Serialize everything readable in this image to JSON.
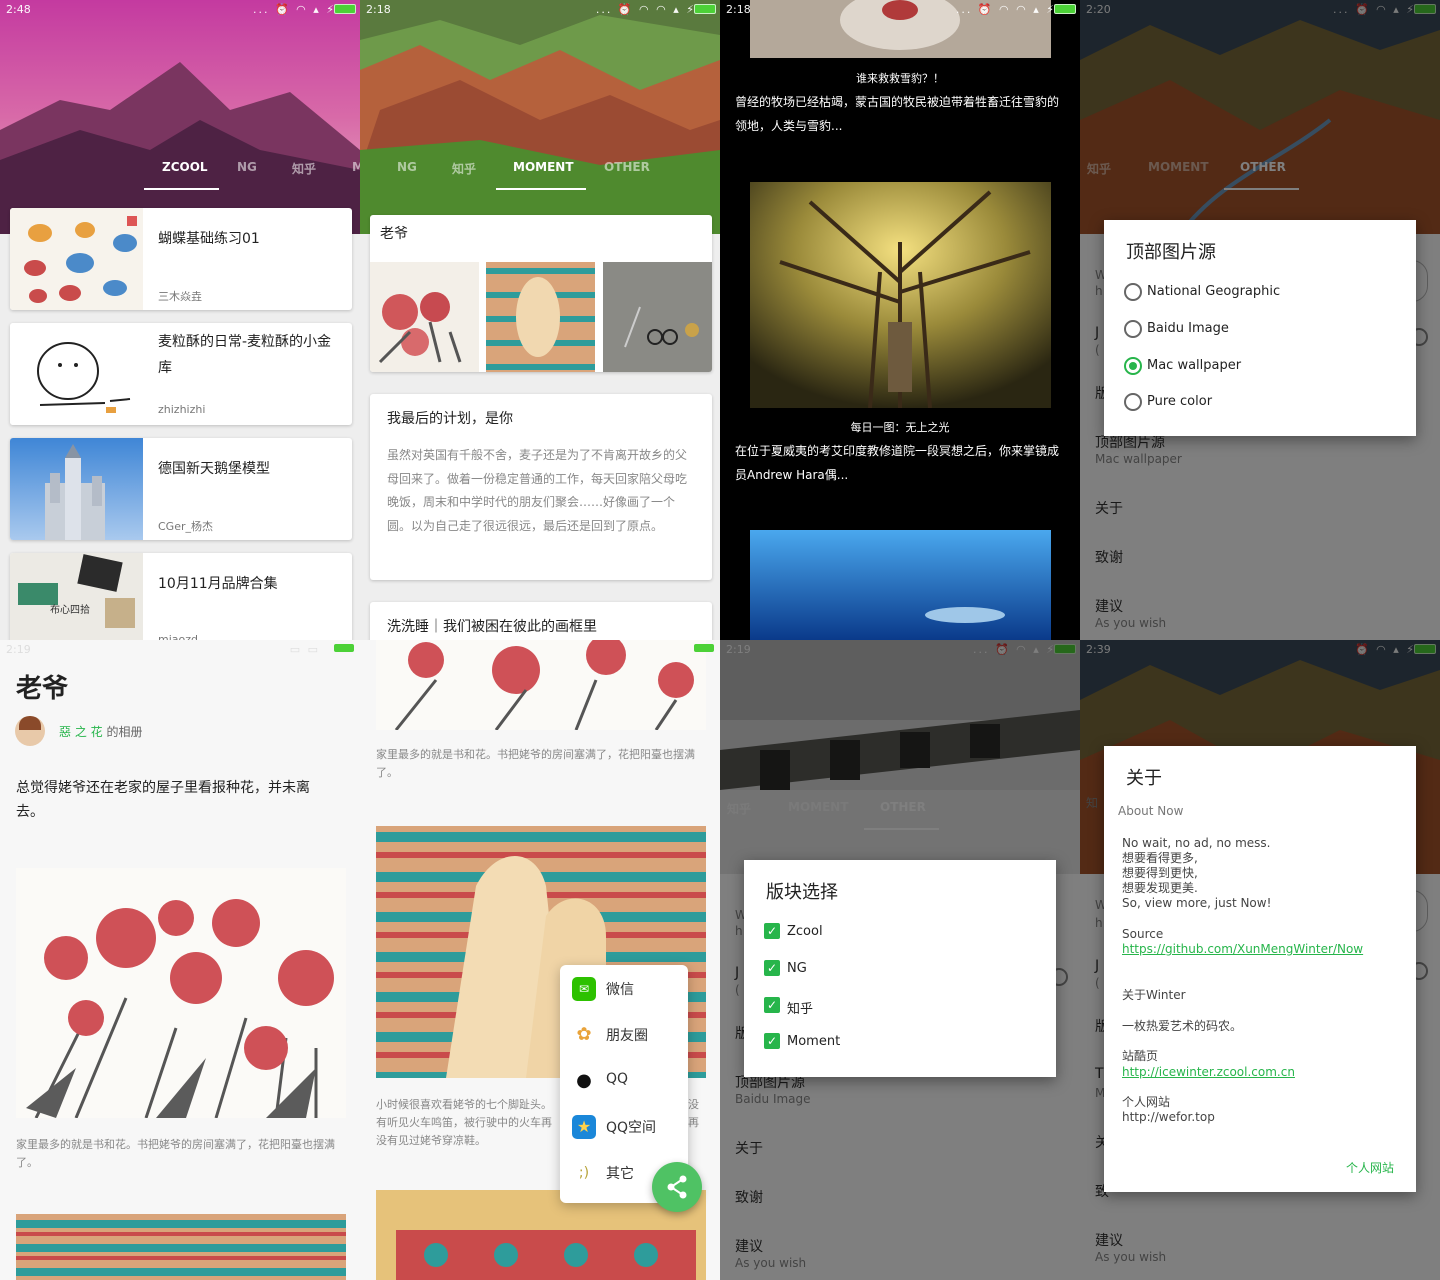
{
  "colors": {
    "accent": "#27b54b",
    "link": "#27b54b"
  },
  "panel1": {
    "status": {
      "time": "2:48",
      "icons": "... ⏰ ◠ ▴ ⚡"
    },
    "tabs": [
      "ZCOOL",
      "NG",
      "知乎",
      "M"
    ],
    "cards": [
      {
        "title": "蝴蝶基础练习01",
        "author": "三木焱垚"
      },
      {
        "title": "麦粒酥的日常-麦粒酥的小金库",
        "author": "zhizhizhi"
      },
      {
        "title": "德国新天鹅堡模型",
        "author": "CGer_杨杰"
      },
      {
        "title": "10月11月品牌合集",
        "author": "miaozd"
      }
    ],
    "thumb4_text": "布心四拾"
  },
  "panel2": {
    "status": {
      "time": "2:18",
      "icons": "... ⏰ ◠ ◠ ▴ ⚡"
    },
    "tabs": [
      "NG",
      "知乎",
      "MOMENT",
      "OTHER"
    ],
    "card1_title": "老爷",
    "card2_title": "我最后的计划，是你",
    "card2_body": "虽然对英国有千般不舍，麦子还是为了不肯离开故乡的父母回来了。做着一份稳定普通的工作，每天回家陪父母吃晚饭，周末和中学时代的朋友们聚会……好像画了一个圆。以为自己走了很远很远，最后还是回到了原点。",
    "card3_title": "洗洗睡｜我们被困在彼此的画框里"
  },
  "panel3": {
    "status": {
      "time": "2:18",
      "icons": "... ⏰ ◠ ◠ ▴ ⚡"
    },
    "item1_caption": "谁来救救雪豹？！",
    "item1_body": "曾经的牧场已经枯竭，蒙古国的牧民被迫带着牲畜迁往雪豹的领地，人类与雪豹...",
    "item2_caption": "每日一图：无上之光",
    "item2_body": "在位于夏威夷的考艾印度教修道院一段冥想之后，你来掌镜成员Andrew Hara偶..."
  },
  "panel4": {
    "status": {
      "time": "2:20",
      "icons": "... ⏰ ◠ ▴ ⚡"
    },
    "tabs": [
      "知乎",
      "MOMENT",
      "OTHER"
    ],
    "dialog_title": "顶部图片源",
    "options": [
      "National Geographic",
      "Baidu Image",
      "Mac wallpaper",
      "Pure color"
    ],
    "selected_index": 2,
    "bg_item_title": "顶部图片源",
    "bg_item_sub": "Mac wallpaper",
    "settings": [
      "关于",
      "致谢",
      "建议"
    ],
    "suggest_sub": "As you wish",
    "peek_letters": [
      "W",
      "h",
      "J",
      "(",
      "版"
    ]
  },
  "panel5": {
    "status": {
      "time": "2:19",
      "icons": "▭ ▭"
    },
    "title": "老爷",
    "author": "惡 之 花",
    "album_suffix": "的相册",
    "desc": "总觉得姥爷还在老家的屋子里看报种花，并未离去。",
    "caption": "家里最多的就是书和花。书把姥爷的房间塞满了，花把阳臺也摆满了。"
  },
  "panel6": {
    "caption1": "家里最多的就是书和花。书把姥爷的房间塞满了，花把阳臺也摆满了。",
    "caption2": "小时候很喜欢看姥爷的七个脚趾头。有听见火车鸣笛，被行驶中的火车再没有见过姥爷穿凉鞋。",
    "caption2_right": "没再",
    "share_items": [
      {
        "label": "微信",
        "icon": "wechat-icon"
      },
      {
        "label": "朋友圈",
        "icon": "moments-icon"
      },
      {
        "label": "QQ",
        "icon": "qq-icon"
      },
      {
        "label": "QQ空间",
        "icon": "qzone-icon"
      },
      {
        "label": "其它",
        "icon": "other-icon"
      }
    ],
    "other_icon_glyph": ";)"
  },
  "panel7": {
    "status": {
      "time": "2:19",
      "icons": "... ⏰ ◠ ▴ ⚡"
    },
    "tabs": [
      "知乎",
      "MOMENT",
      "OTHER"
    ],
    "dialog_title": "版块选择",
    "options": [
      "Zcool",
      "NG",
      "知乎",
      "Moment"
    ],
    "bg_item_title": "顶部图片源",
    "bg_item_sub": "Baidu Image",
    "settings": [
      "关于",
      "致谢",
      "建议"
    ],
    "suggest_sub": "As you wish",
    "peek_letters": [
      "W",
      "h",
      "J",
      "(",
      "版"
    ]
  },
  "panel8": {
    "status": {
      "time": "2:39",
      "icons": "⏰ ◠ ▴ ⚡"
    },
    "dialog_title": "关于",
    "about_now": "About Now",
    "lines": [
      "No wait, no ad, no mess.",
      "想要看得更多,",
      "想要得到更快,",
      "想要发现更美.",
      "So, view more, just Now!"
    ],
    "source_label": "Source",
    "source_link": "https://github.com/XunMengWinter/Now",
    "about_winter": "关于Winter",
    "winter_desc": "一枚热爱艺术的码农。",
    "zcool_label": "站酷页",
    "zcool_link": "http://icewinter.zcool.com.cn",
    "site_label": "个人网站",
    "site_url": "http://wefor.top",
    "action": "个人网站",
    "settings_visible": [
      "致",
      "建议"
    ],
    "suggest_sub": "As you wish",
    "peek_letters": [
      "知",
      "W",
      "h",
      "J",
      "(",
      "版",
      "T",
      "M",
      "关"
    ]
  }
}
